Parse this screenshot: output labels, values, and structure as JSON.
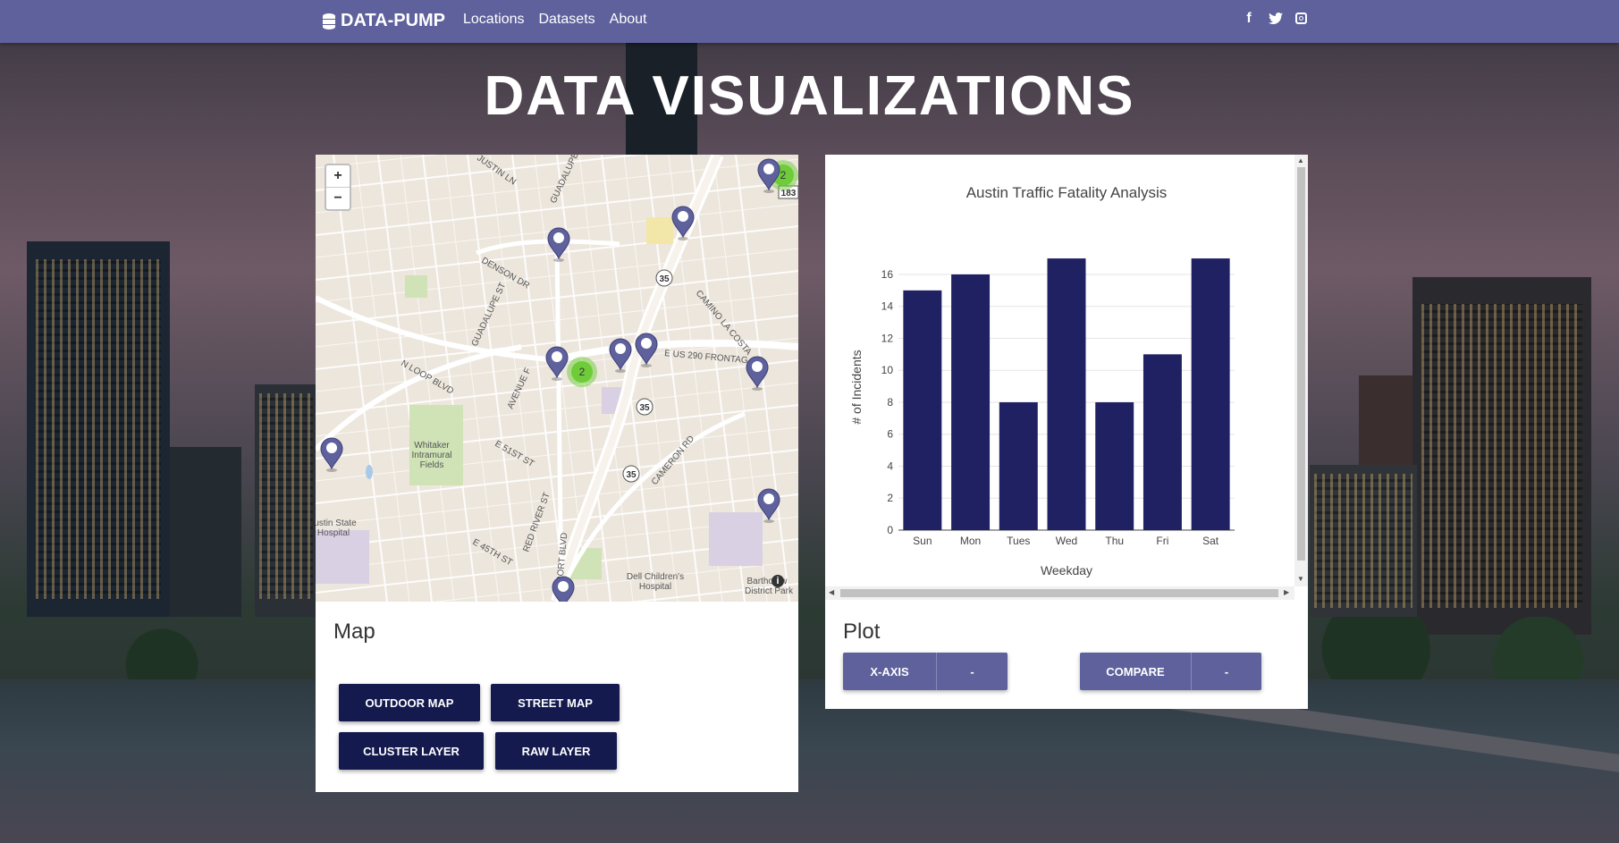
{
  "nav": {
    "brand": "DATA-PUMP",
    "links": [
      "Locations",
      "Datasets",
      "About"
    ],
    "social": [
      "facebook-icon",
      "twitter-icon",
      "instagram-icon"
    ]
  },
  "page": {
    "title": "DATA VISUALIZATIONS"
  },
  "map": {
    "title": "Map",
    "zoom_in": "+",
    "zoom_out": "−",
    "info": "i",
    "labels": {
      "whitaker": "Whitaker\nIntramural\nFields",
      "austin_state": "ustin State\nHospital",
      "dell": "Dell Children's\nHospital",
      "bartholomew": "Bartho ew\nDistrict Park",
      "streets": [
        "JUSTIN LN",
        "GUADALUPE",
        "DENSON DR",
        "GUADALUPE ST",
        "N LOOP BLVD",
        "AVENUE F",
        "E 51ST ST",
        "E 45TH ST",
        "RED RIVER ST",
        "AIRPORT BLVD",
        "CAMERON RD",
        "CAMINO LA COSTA",
        "E US 290 FRONTAG",
        "35",
        "183"
      ]
    },
    "clusters": [
      "2",
      "2"
    ],
    "buttons": {
      "outdoor": "OUTDOOR MAP",
      "street": "STREET MAP",
      "cluster": "CLUSTER LAYER",
      "raw": "RAW LAYER"
    }
  },
  "plot": {
    "title": "Plot",
    "xaxis_button": "X-AXIS",
    "compare_button": "COMPARE",
    "caret": "-"
  },
  "chart_data": {
    "type": "bar",
    "title": "Austin Traffic Fatality Analysis",
    "xlabel": "Weekday",
    "ylabel": "# of Incidents",
    "categories": [
      "Sun",
      "Mon",
      "Tues",
      "Wed",
      "Thu",
      "Fri",
      "Sat"
    ],
    "values": [
      15,
      16,
      8,
      17,
      8,
      11,
      17
    ],
    "yticks": [
      0,
      2,
      4,
      6,
      8,
      10,
      12,
      14,
      16
    ],
    "ylim": [
      0,
      17.9
    ],
    "color": "#1f2162",
    "grid": true
  }
}
